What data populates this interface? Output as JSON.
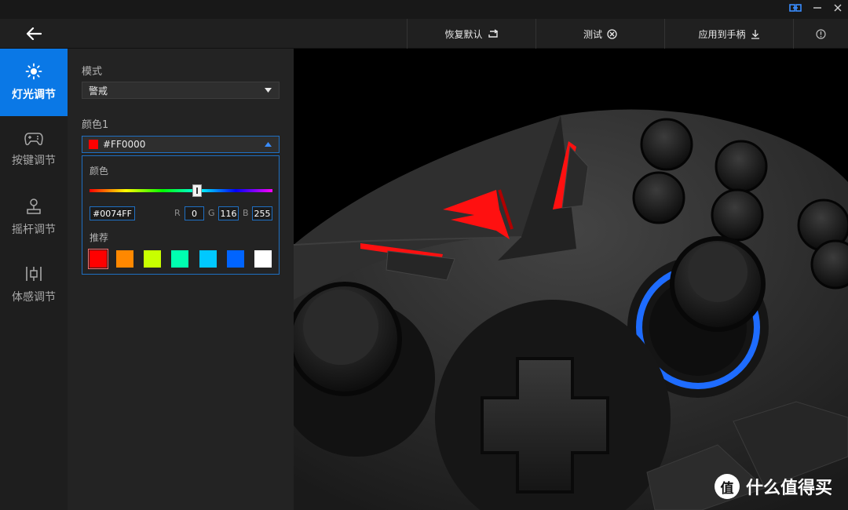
{
  "window": {
    "controls": [
      {
        "name": "link-icon",
        "glyph": "⊟"
      },
      {
        "name": "minimize-icon",
        "glyph": "—"
      },
      {
        "name": "close-icon",
        "glyph": "✕"
      }
    ]
  },
  "toolbar": {
    "reset_label": "恢复默认",
    "test_label": "测试",
    "apply_label": "应用到手柄",
    "info_icon": "info-icon"
  },
  "sidebar": {
    "items": [
      {
        "label": "灯光调节",
        "icon": "sun-icon",
        "active": true
      },
      {
        "label": "按键调节",
        "icon": "gamepad-icon",
        "active": false
      },
      {
        "label": "摇杆调节",
        "icon": "joystick-icon",
        "active": false
      },
      {
        "label": "体感调节",
        "icon": "motion-icon",
        "active": false
      }
    ]
  },
  "panel": {
    "mode_label": "模式",
    "mode_value": "警戒",
    "color1_label": "颜色1",
    "color1_value": "#FF0000",
    "picker": {
      "title": "颜色",
      "hex": "#0074FF",
      "r_label": "R",
      "r": "0",
      "g_label": "G",
      "g": "116",
      "b_label": "B",
      "b": "255",
      "recommend_label": "推荐",
      "swatches": [
        "#ff0000",
        "#ff8800",
        "#c8ff00",
        "#00ffb0",
        "#00c8ff",
        "#0064ff",
        "#ffffff"
      ]
    }
  },
  "watermark": {
    "text": "什么值得买",
    "badge": "值"
  },
  "colors": {
    "accent": "#0a78e6",
    "red_led": "#ff1010",
    "blue_led": "#1e6cff"
  }
}
